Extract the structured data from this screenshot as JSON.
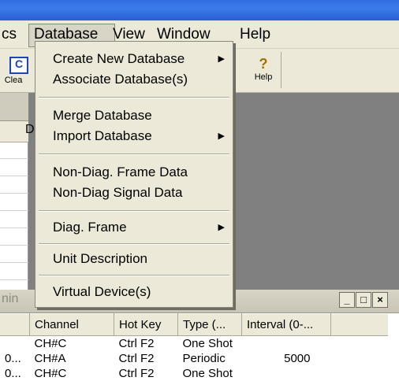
{
  "menubar": {
    "items": [
      "cs",
      "Database",
      "View",
      "Window",
      "Help"
    ]
  },
  "toolbar": {
    "clear_icon_letter": "C",
    "clear_label": "Clea",
    "help_label": "Help",
    "help_icon": "question-icon"
  },
  "upper_panel": {
    "header_fragment": "D"
  },
  "database_menu": {
    "items": [
      {
        "label": "Create New Database",
        "submenu": true
      },
      {
        "label": "Associate Database(s)",
        "submenu": false
      },
      {
        "label": "Merge Database",
        "submenu": false
      },
      {
        "label": "Import Database",
        "submenu": true
      },
      {
        "label": "Non-Diag. Frame Data",
        "submenu": false
      },
      {
        "label": "Non-Diag Signal Data",
        "submenu": false
      },
      {
        "label": "Diag. Frame",
        "submenu": true
      },
      {
        "label": "Unit Description",
        "submenu": false
      },
      {
        "label": "Virtual Device(s)",
        "submenu": false
      }
    ]
  },
  "lower_window": {
    "title_fragment": "nin",
    "buttons": {
      "minimize": "_",
      "maximize": "□",
      "close": "×"
    },
    "table": {
      "headers": [
        "",
        "Channel",
        "Hot Key",
        "Type  (...",
        "Interval (0-..."
      ],
      "rows": [
        [
          "",
          "CH#C",
          "Ctrl F2",
          "One Shot",
          ""
        ],
        [
          "0...",
          "CH#A",
          "Ctrl F2",
          "Periodic",
          "5000"
        ],
        [
          "0...",
          "CH#C",
          "Ctrl F2",
          "One Shot",
          ""
        ]
      ]
    }
  }
}
